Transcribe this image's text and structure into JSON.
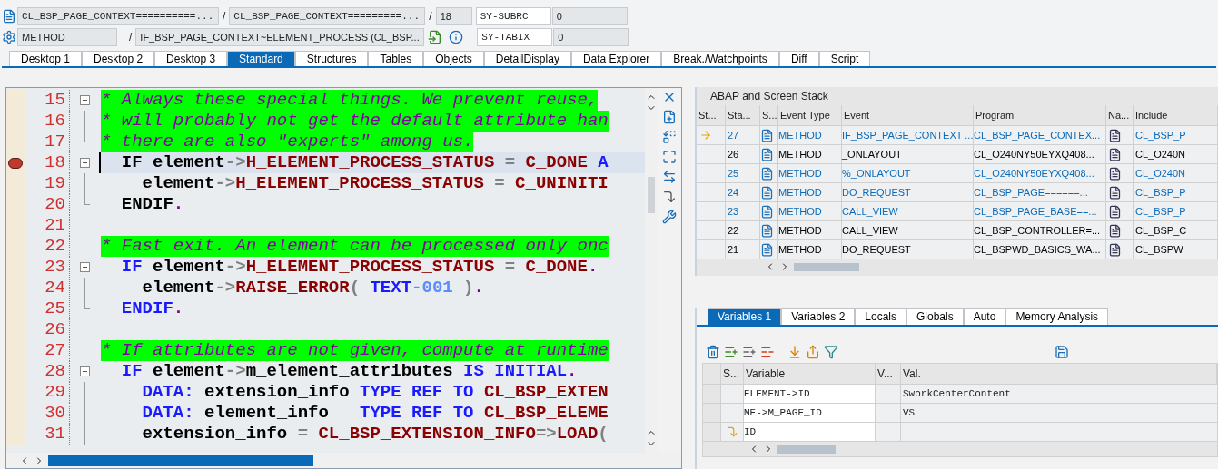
{
  "context": {
    "include": "CL_BSP_PAGE_CONTEXT==========...",
    "program": "CL_BSP_PAGE_CONTEXT=========...",
    "line": "18",
    "event_type": "METHOD",
    "event": "IF_BSP_PAGE_CONTEXT~ELEMENT_PROCESS (CL_BSP...",
    "separators": [
      "/",
      "/",
      "/"
    ]
  },
  "sysvars": [
    {
      "name": "SY-SUBRC",
      "value": "0"
    },
    {
      "name": "SY-TABIX",
      "value": "0"
    }
  ],
  "tabs": [
    {
      "label": "Desktop 1",
      "selected": false
    },
    {
      "label": "Desktop 2",
      "selected": false
    },
    {
      "label": "Desktop 3",
      "selected": false
    },
    {
      "label": "Standard",
      "selected": true
    },
    {
      "label": "Structures",
      "selected": false
    },
    {
      "label": "Tables",
      "selected": false
    },
    {
      "label": "Objects",
      "selected": false
    },
    {
      "label": "DetailDisplay",
      "selected": false
    },
    {
      "label": "Data Explorer",
      "selected": false
    },
    {
      "label": "Break./Watchpoints",
      "selected": false
    },
    {
      "label": "Diff",
      "selected": false
    },
    {
      "label": "Script",
      "selected": false
    }
  ],
  "editor": {
    "lines": [
      {
        "number": "15",
        "kind": "open",
        "current": false,
        "breakpoint": false,
        "comment": "* Always these special things. We prevent reuse,"
      },
      {
        "number": "16",
        "kind": "line",
        "current": false,
        "breakpoint": false,
        "comment": "* will probably not get the default attribute han"
      },
      {
        "number": "17",
        "kind": "end",
        "current": false,
        "breakpoint": false,
        "comment": "* there are also \"experts\" among us."
      },
      {
        "number": "18",
        "kind": "open",
        "current": true,
        "breakpoint": true,
        "tokens": [
          {
            "kind": "plainkw",
            "text": "  IF"
          },
          {
            "kind": "name",
            "text": " element"
          },
          {
            "kind": "op",
            "text": "->"
          },
          {
            "kind": "attr",
            "text": "H_ELEMENT_PROCESS_STATUS"
          },
          {
            "kind": "op",
            "text": " = "
          },
          {
            "kind": "attr",
            "text": "C_DONE"
          },
          {
            "kind": "kw",
            "text": " A"
          }
        ]
      },
      {
        "number": "19",
        "kind": "line",
        "current": false,
        "breakpoint": false,
        "tokens": [
          {
            "kind": "name",
            "text": "    element"
          },
          {
            "kind": "op",
            "text": "->"
          },
          {
            "kind": "attr",
            "text": "H_ELEMENT_PROCESS_STATUS"
          },
          {
            "kind": "op",
            "text": " = "
          },
          {
            "kind": "attr",
            "text": "C_UNINITI"
          }
        ]
      },
      {
        "number": "20",
        "kind": "end",
        "current": false,
        "breakpoint": false,
        "tokens": [
          {
            "kind": "plainkw",
            "text": "  ENDIF"
          },
          {
            "kind": "dot",
            "text": "."
          }
        ]
      },
      {
        "number": "21",
        "kind": "none",
        "breakpoint": false
      },
      {
        "number": "22",
        "kind": "none",
        "current": false,
        "breakpoint": false,
        "comment": "* Fast exit. An element can be processed only onc"
      },
      {
        "number": "23",
        "kind": "open",
        "current": false,
        "breakpoint": false,
        "tokens": [
          {
            "kind": "kw",
            "text": "  IF"
          },
          {
            "kind": "name",
            "text": " element"
          },
          {
            "kind": "op",
            "text": "->"
          },
          {
            "kind": "attr",
            "text": "H_ELEMENT_PROCESS_STATUS"
          },
          {
            "kind": "op",
            "text": " = "
          },
          {
            "kind": "attr",
            "text": "C_DONE"
          },
          {
            "kind": "dot",
            "text": "."
          }
        ]
      },
      {
        "number": "24",
        "kind": "line",
        "current": false,
        "breakpoint": false,
        "tokens": [
          {
            "kind": "name",
            "text": "    element"
          },
          {
            "kind": "op",
            "text": "->"
          },
          {
            "kind": "attr",
            "text": "RAISE_ERROR"
          },
          {
            "kind": "op",
            "text": "( "
          },
          {
            "kind": "kw",
            "text": "TEXT"
          },
          {
            "kind": "num",
            "text": "-001"
          },
          {
            "kind": "op",
            "text": " )"
          },
          {
            "kind": "dot",
            "text": "."
          }
        ]
      },
      {
        "number": "25",
        "kind": "end",
        "current": false,
        "breakpoint": false,
        "tokens": [
          {
            "kind": "kw",
            "text": "  ENDIF"
          },
          {
            "kind": "dot",
            "text": "."
          }
        ]
      },
      {
        "number": "26",
        "kind": "none",
        "breakpoint": false
      },
      {
        "number": "27",
        "kind": "none",
        "current": false,
        "breakpoint": false,
        "comment": "* If attributes are not given, compute at runtime"
      },
      {
        "number": "28",
        "kind": "open",
        "current": false,
        "breakpoint": false,
        "tokens": [
          {
            "kind": "kw",
            "text": "  IF"
          },
          {
            "kind": "name",
            "text": " element"
          },
          {
            "kind": "op",
            "text": "->"
          },
          {
            "kind": "name",
            "text": "m_element_attributes"
          },
          {
            "kind": "kw",
            "text": " IS INITIAL"
          },
          {
            "kind": "dot",
            "text": "."
          }
        ]
      },
      {
        "number": "29",
        "kind": "line",
        "current": false,
        "breakpoint": false,
        "tokens": [
          {
            "kind": "kw",
            "text": "    DATA:"
          },
          {
            "kind": "name",
            "text": " extension_info"
          },
          {
            "kind": "kw",
            "text": " TYPE REF TO"
          },
          {
            "kind": "attr",
            "text": " CL_BSP_EXTEN"
          }
        ]
      },
      {
        "number": "30",
        "kind": "line",
        "current": false,
        "breakpoint": false,
        "tokens": [
          {
            "kind": "kw",
            "text": "    DATA:"
          },
          {
            "kind": "name",
            "text": " element_info"
          },
          {
            "kind": "kw",
            "text": "   TYPE REF TO"
          },
          {
            "kind": "attr",
            "text": " CL_BSP_ELEME"
          }
        ]
      },
      {
        "number": "31",
        "kind": "line",
        "current": false,
        "breakpoint": false,
        "tokens": [
          {
            "kind": "name",
            "text": "    extension_info"
          },
          {
            "kind": "op",
            "text": " = "
          },
          {
            "kind": "attr",
            "text": "CL_BSP_EXTENSION_INFO"
          },
          {
            "kind": "op",
            "text": "=>"
          },
          {
            "kind": "attr",
            "text": "LOAD"
          },
          {
            "kind": "op",
            "text": "("
          }
        ]
      }
    ]
  },
  "stack": {
    "title": "ABAP and Screen Stack",
    "columns": [
      "St...",
      "Sta...",
      "S...",
      "Event Type",
      "Event",
      "Program",
      "Na...",
      "Include"
    ],
    "rows": [
      {
        "current": true,
        "link": true,
        "level": "27",
        "event_type": "METHOD",
        "event": "IF_BSP_PAGE_CONTEXT ...",
        "program": "CL_BSP_PAGE_CONTEX...",
        "include": "CL_BSP_P"
      },
      {
        "current": false,
        "link": false,
        "level": "26",
        "event_type": "METHOD",
        "event": "_ONLAYOUT",
        "program": "CL_O240NY50EYXQ408...",
        "include": "CL_O240N"
      },
      {
        "current": false,
        "link": true,
        "level": "25",
        "event_type": "METHOD",
        "event": "%_ONLAYOUT",
        "program": "CL_O240NY50EYXQ408...",
        "include": "CL_O240N"
      },
      {
        "current": false,
        "link": true,
        "level": "24",
        "event_type": "METHOD",
        "event": "DO_REQUEST",
        "program": "CL_BSP_PAGE======...",
        "include": "CL_BSP_P"
      },
      {
        "current": false,
        "link": true,
        "level": "23",
        "event_type": "METHOD",
        "event": "CALL_VIEW",
        "program": "CL_BSP_PAGE_BASE==...",
        "include": "CL_BSP_P"
      },
      {
        "current": false,
        "link": false,
        "level": "22",
        "event_type": "METHOD",
        "event": "CALL_VIEW",
        "program": "CL_BSP_CONTROLLER=...",
        "include": "CL_BSP_C"
      },
      {
        "current": false,
        "link": false,
        "level": "21",
        "event_type": "METHOD",
        "event": "DO_REQUEST",
        "program": "CL_BSPWD_BASICS_WA...",
        "include": "CL_BSPW"
      }
    ]
  },
  "variables": {
    "tabs": [
      {
        "label": "Variables 1",
        "selected": true
      },
      {
        "label": "Variables 2",
        "selected": false
      },
      {
        "label": "Locals",
        "selected": false
      },
      {
        "label": "Globals",
        "selected": false
      },
      {
        "label": "Auto",
        "selected": false
      },
      {
        "label": "Memory Analysis",
        "selected": false
      }
    ],
    "columns": [
      "S...",
      "Variable",
      "V...",
      "Val."
    ],
    "rows": [
      {
        "watch": false,
        "variable": "ELEMENT->ID",
        "value": "$workCenterContent"
      },
      {
        "watch": false,
        "variable": "ME->M_PAGE_ID",
        "value": "VS"
      },
      {
        "watch": true,
        "variable": "ID"
      }
    ]
  }
}
